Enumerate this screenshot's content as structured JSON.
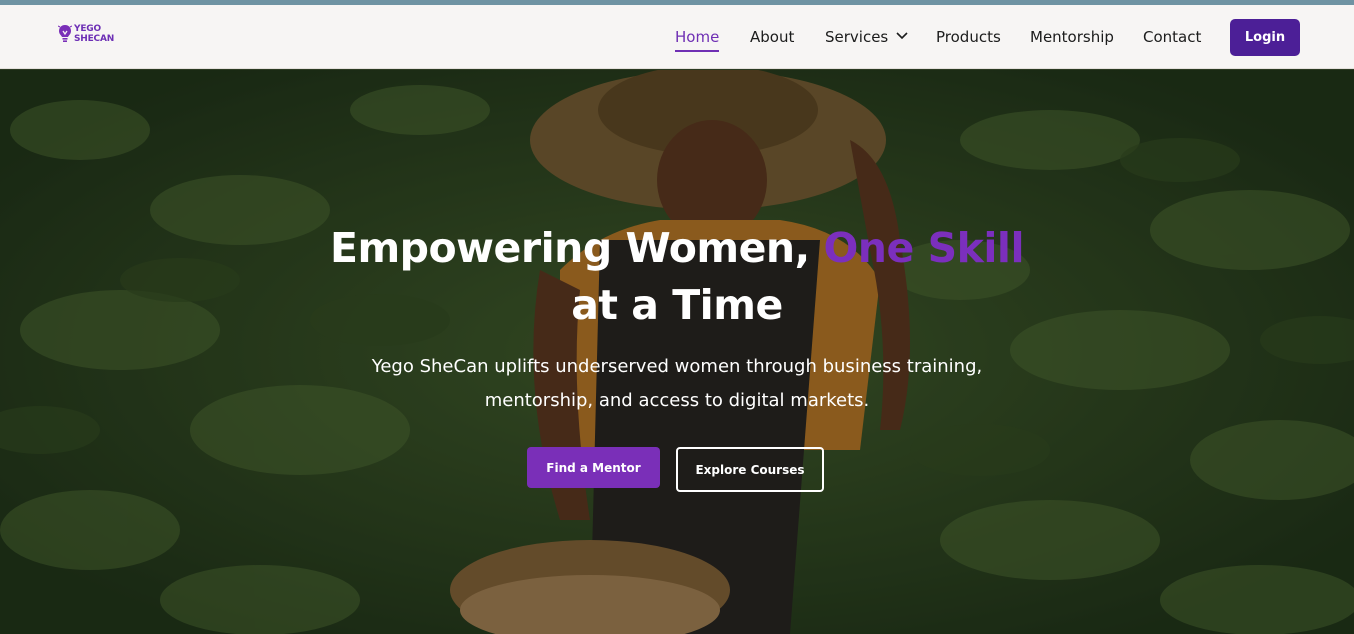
{
  "brand": {
    "logo_line1": "YEGO",
    "logo_line2": "SHECAN",
    "color": "#6d2fb5"
  },
  "nav": {
    "items": [
      {
        "label": "Home",
        "active": true
      },
      {
        "label": "About"
      },
      {
        "label": "Services",
        "has_dropdown": true
      },
      {
        "label": "Products"
      },
      {
        "label": "Mentorship"
      },
      {
        "label": "Contact"
      }
    ],
    "login_label": "Login",
    "accent": "#6f2fb4",
    "login_color": "#4c1f97"
  },
  "hero": {
    "headline_part1": "Empowering Women, ",
    "headline_accent": "One Skill",
    "headline_part2": "at a Time",
    "subtext_line1": "Yego SheCan uplifts underserved women through business training,",
    "subtext_line2": "mentorship, and access to digital markets.",
    "primary_cta": "Find a Mentor",
    "secondary_cta": "Explore Courses",
    "accent_color": "#7b2fbd",
    "background_image": "smiling woman in straw hat holding basket of peanuts in a cassava field"
  }
}
